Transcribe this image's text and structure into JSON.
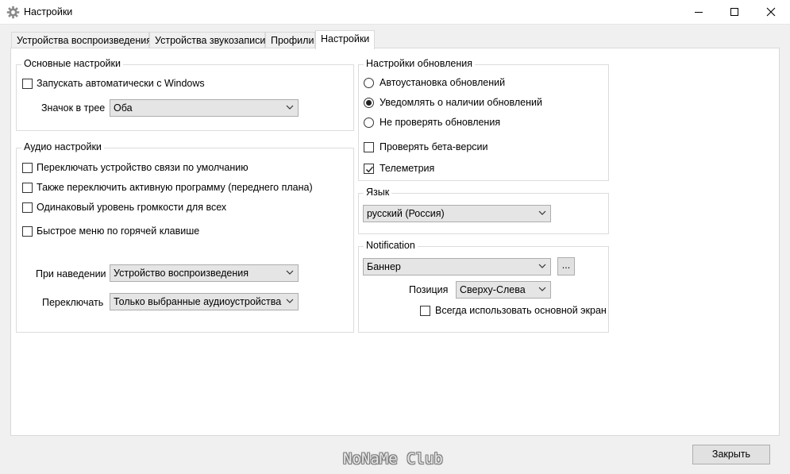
{
  "window": {
    "title": "Настройки",
    "icon": "gear-icon",
    "controls": [
      "minimize-icon",
      "maximize-icon",
      "close-icon"
    ]
  },
  "tabs": [
    {
      "label": "Устройства воспроизведения",
      "active": false
    },
    {
      "label": "Устройства звукозаписи",
      "active": false
    },
    {
      "label": "Профили",
      "active": false
    },
    {
      "label": "Настройки",
      "active": true
    }
  ],
  "basic": {
    "title": "Основные настройки",
    "autostart": {
      "label": "Запускать автоматически с Windows",
      "checked": false
    },
    "tray_label": "Значок в трее",
    "tray_value": "Оба"
  },
  "audio": {
    "title": "Аудио настройки",
    "options": [
      {
        "label": "Переключать устройство связи по умолчанию",
        "checked": false
      },
      {
        "label": "Также переключить активную программу (переднего плана)",
        "checked": false
      },
      {
        "label": "Одинаковый уровень громкости для всех",
        "checked": false
      },
      {
        "label": "Быстрое меню по горячей клавише",
        "checked": false
      }
    ],
    "hover_label": "При наведении",
    "hover_value": "Устройство воспроизведения",
    "switch_label": "Переключать",
    "switch_value": "Только выбранные аудиоустройства"
  },
  "updates": {
    "title": "Настройки обновления",
    "radios": [
      {
        "label": "Автоустановка обновлений",
        "selected": false
      },
      {
        "label": "Уведомлять о наличии обновлений",
        "selected": true
      },
      {
        "label": "Не проверять обновления",
        "selected": false
      }
    ],
    "beta": {
      "label": "Проверять бета-версии",
      "checked": false
    },
    "telemetry": {
      "label": "Телеметрия",
      "checked": true
    }
  },
  "language": {
    "title": "Язык",
    "value": "русский (Россия)"
  },
  "notification": {
    "title": "Notification",
    "value": "Баннер",
    "more_label": "...",
    "position_label": "Позиция",
    "position_value": "Сверху-Слева",
    "main_screen": {
      "label": "Всегда использовать основной экран",
      "checked": false
    }
  },
  "footer": {
    "close_label": "Закрыть",
    "watermark": "NoNaMe Club"
  }
}
